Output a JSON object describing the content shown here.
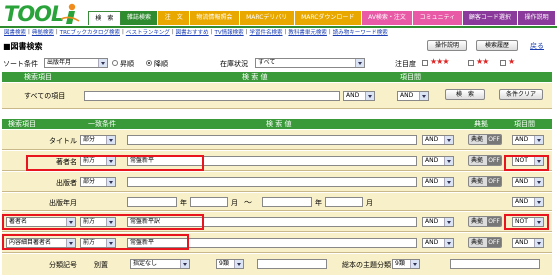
{
  "logo": {
    "text": "TOOL"
  },
  "tabs": [
    {
      "label": "検　索",
      "color": "#2e8b2e",
      "active": true
    },
    {
      "label": "雑誌検索",
      "color": "#2e8b2e"
    },
    {
      "label": "注　文",
      "color": "#e8a800"
    },
    {
      "label": "物流情報照会",
      "color": "#e8a800"
    },
    {
      "label": "MARCデリバリ",
      "color": "#e8a800"
    },
    {
      "label": "MARCダウンロード",
      "color": "#e8a800"
    },
    {
      "label": "AV検索・注文",
      "color": "#e85aa6"
    },
    {
      "label": "コミュニティ",
      "color": "#e85aa6"
    },
    {
      "label": "顧客コード選択",
      "color": "#8a3a9a"
    },
    {
      "label": "操作説明",
      "color": "#8a3a9a"
    }
  ],
  "subnav": [
    "図書検索",
    "典拠検索",
    "TRCブックカタログ検索",
    "ベストランキング",
    "図書おすすめ",
    "TV情報検索",
    "学習件名検索",
    "教科書単元検索",
    "読み物キーワード検索"
  ],
  "page_title": "■図書検索",
  "buttons": {
    "operation": "操作説明",
    "history": "検索履歴",
    "back": "戻る"
  },
  "sort": {
    "label": "ソート条件",
    "value": "出版年月",
    "asc": "昇順",
    "desc": "降順",
    "stock_label": "在庫状況",
    "stock_value": "すべて",
    "attention_label": "注目度"
  },
  "simple": {
    "col_item": "検索項目",
    "col_value": "検 索 値",
    "col_between": "項目間",
    "row_label": "すべての項目",
    "and": "AND",
    "search": "検　索",
    "clear": "条件クリア"
  },
  "detail_header": {
    "item": "検索項目",
    "match": "一致条件",
    "value": "検 索 値",
    "tenkyo": "典拠",
    "between": "項目間"
  },
  "rows": [
    {
      "label": "タイトル",
      "match": "部分",
      "value": "",
      "op": "AND",
      "tenkyo": "典拠",
      "toggle": "OFF",
      "between": "AND"
    },
    {
      "label": "著者名",
      "match": "前方",
      "value": "常盤新平",
      "op": "AND",
      "tenkyo": "典拠",
      "toggle": "OFF",
      "between": "NOT"
    },
    {
      "label": "出版者",
      "match": "部分",
      "value": "",
      "op": "AND",
      "tenkyo": "典拠",
      "toggle": "OFF",
      "between": "AND"
    },
    {
      "label": "出版年月",
      "year": "年",
      "month": "月",
      "tilde": "〜",
      "between": "AND"
    },
    {
      "label": "著者名",
      "match": "前方",
      "value": "常盤新平訳",
      "op": "AND",
      "tenkyo": "典拠",
      "toggle": "OFF",
      "between": "NOT"
    },
    {
      "label": "内容細目著者名",
      "match": "前方",
      "value": "常盤新平",
      "op": "AND",
      "tenkyo": "典拠",
      "toggle": "OFF",
      "between": "AND"
    }
  ],
  "last_row": {
    "label": "分類記号",
    "sep_label": "別置",
    "sep_value": "指定なし",
    "digit_value": "9類",
    "subject_label": "総本の主題分類",
    "subject_value": "9類"
  },
  "colors": {
    "green": "#3a9a3a",
    "row_bg": "#f8f0c8",
    "highlight": "#e8141e",
    "star": "#d22"
  }
}
